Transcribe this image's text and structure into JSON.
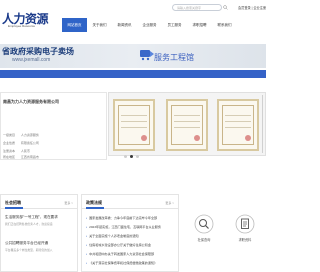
{
  "header": {
    "logo_text": "人力资源",
    "logo_subtext": "Employee Resource",
    "search_placeholder": "请输入搜索关键字",
    "login_text": "会员登录 | 企业注册"
  },
  "nav": {
    "items": [
      {
        "label": "网站首页",
        "active": true
      },
      {
        "label": "关于我们",
        "active": false
      },
      {
        "label": "新闻资讯",
        "active": false
      },
      {
        "label": "企业服务",
        "active": false
      },
      {
        "label": "员工服务",
        "active": false
      },
      {
        "label": "求职招聘",
        "active": false
      },
      {
        "label": "联系我们",
        "active": false
      }
    ]
  },
  "banner": {
    "title": "省政府采购电子卖场",
    "url": "www.jxemall.com",
    "service": "服务工程馆"
  },
  "company": {
    "name": "南昌为力人力资源服务有限公司",
    "rows": [
      {
        "key": "一级类目",
        "value": "人力资源服务"
      },
      {
        "key": "企业性质",
        "value": "有限责任公司"
      },
      {
        "key": "注册资本",
        "value": "人民币"
      },
      {
        "key": "所在地区",
        "value": "江西省南昌市"
      }
    ]
  },
  "carousel": {
    "count": 3,
    "active_index": 1
  },
  "social": {
    "title": "社会招聘",
    "more": "更多 >",
    "items": [
      {
        "title": "生活服务部\"一号工程\"，现在要求",
        "desc": "我们正在招聘各类优秀人才，欢迎投递"
      },
      {
        "title": "公共招聘服务平台已经开通",
        "desc": "平台覆盖多个岗位类型，期待您的加入"
      }
    ]
  },
  "policy": {
    "title": "政策法规",
    "more": "更多 >",
    "items": [
      "国家发展改革委：力争今年底前下达完毕今年全部",
      "2023年起实施，江西门面住宅、互联网平台从业服务",
      "关于全面实施个人养老金制度的通知",
      "住房和城乡建设部办公厅关于做好住房公积金",
      "中共和团中办关于转发国家人力资源社会保障部",
      "《关于落实社保降费率和社保费缓缴政策的通知》"
    ]
  },
  "services": [
    {
      "label": "社保查询",
      "icon": "search-social-icon"
    },
    {
      "label": "求职资料",
      "icon": "document-icon"
    }
  ],
  "colors": {
    "brand": "#2f64c8",
    "logo": "#1a3a8a"
  }
}
